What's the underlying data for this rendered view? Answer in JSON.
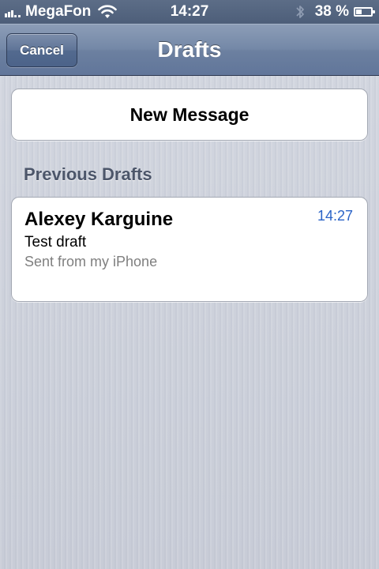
{
  "status_bar": {
    "carrier": "MegaFon",
    "time": "14:27",
    "battery_text": "38 %",
    "battery_level": 0.38,
    "icons": [
      "signal-icon",
      "wifi-icon",
      "bluetooth-icon",
      "battery-icon"
    ]
  },
  "nav": {
    "cancel_label": "Cancel",
    "title": "Drafts"
  },
  "new_message_label": "New Message",
  "section_header": "Previous Drafts",
  "drafts": [
    {
      "sender": "Alexey Karguine",
      "time": "14:27",
      "subject": "Test draft",
      "preview": "Sent from my iPhone"
    }
  ],
  "colors": {
    "time_blue": "#2a63c7",
    "nav_bar": "#6c80a0",
    "background": "#c9cdd8"
  }
}
